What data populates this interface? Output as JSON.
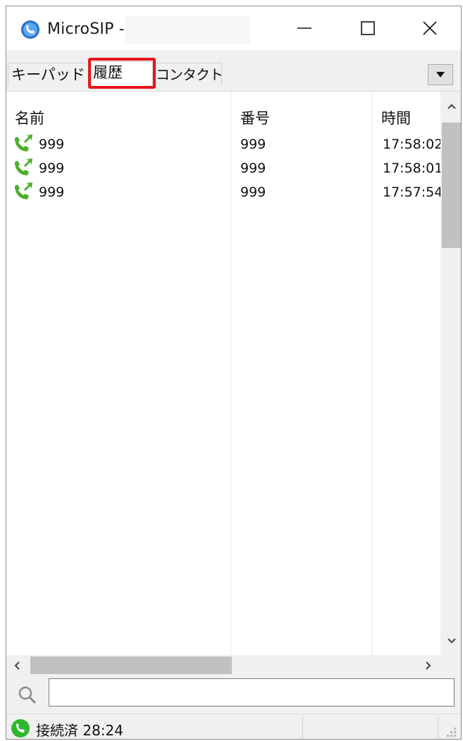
{
  "window": {
    "title": "MicroSIP -"
  },
  "tabs": [
    {
      "label": "キーパッド"
    },
    {
      "label": "履歴"
    },
    {
      "label": "コンタクト"
    }
  ],
  "table": {
    "columns": [
      "名前",
      "番号",
      "時間"
    ],
    "rows": [
      {
        "name": "999",
        "number": "999",
        "time": "17:58:02"
      },
      {
        "name": "999",
        "number": "999",
        "time": "17:58:01"
      },
      {
        "name": "999",
        "number": "999",
        "time": "17:57:54"
      }
    ]
  },
  "search": {
    "value": "",
    "placeholder": ""
  },
  "status": {
    "text": "接続済 28:24"
  },
  "colors": {
    "accent_call": "#4caf2a",
    "highlight": "#e8141b",
    "status_ok": "#2eb82e"
  },
  "icons": {
    "app": "microsip-logo-icon",
    "call": "outgoing-call-icon",
    "search": "search-icon",
    "status": "connected-icon"
  }
}
